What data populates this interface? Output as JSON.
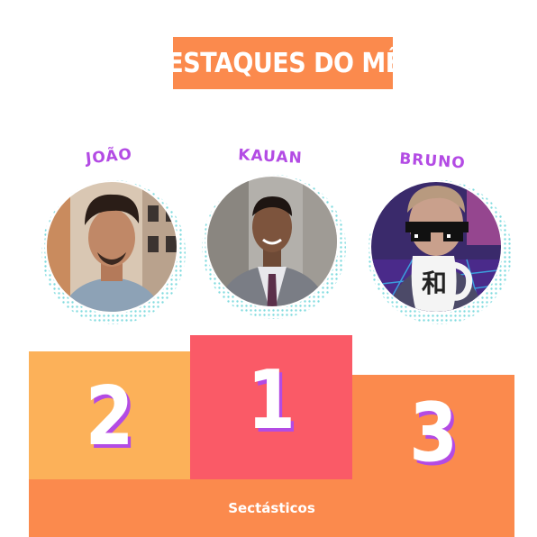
{
  "header": {
    "title": "DESTAQUES DO MÊS"
  },
  "podium": {
    "places": [
      {
        "rank": "2",
        "name": "JOÃO"
      },
      {
        "rank": "1",
        "name": "KAUAN"
      },
      {
        "rank": "3",
        "name": "BRUNO"
      }
    ],
    "base_label": "Sectásticos"
  },
  "colors": {
    "title_bg": "#fb8a4d",
    "name": "#b34be4",
    "second_block": "#fcb159",
    "first_block": "#fa5a67",
    "third_block": "#fb8a4d",
    "base": "#fb8a4d",
    "rank_shadow": "#b34be4",
    "avatar_dots": "#5fd1d6"
  },
  "mug": {
    "glyph": "和"
  }
}
